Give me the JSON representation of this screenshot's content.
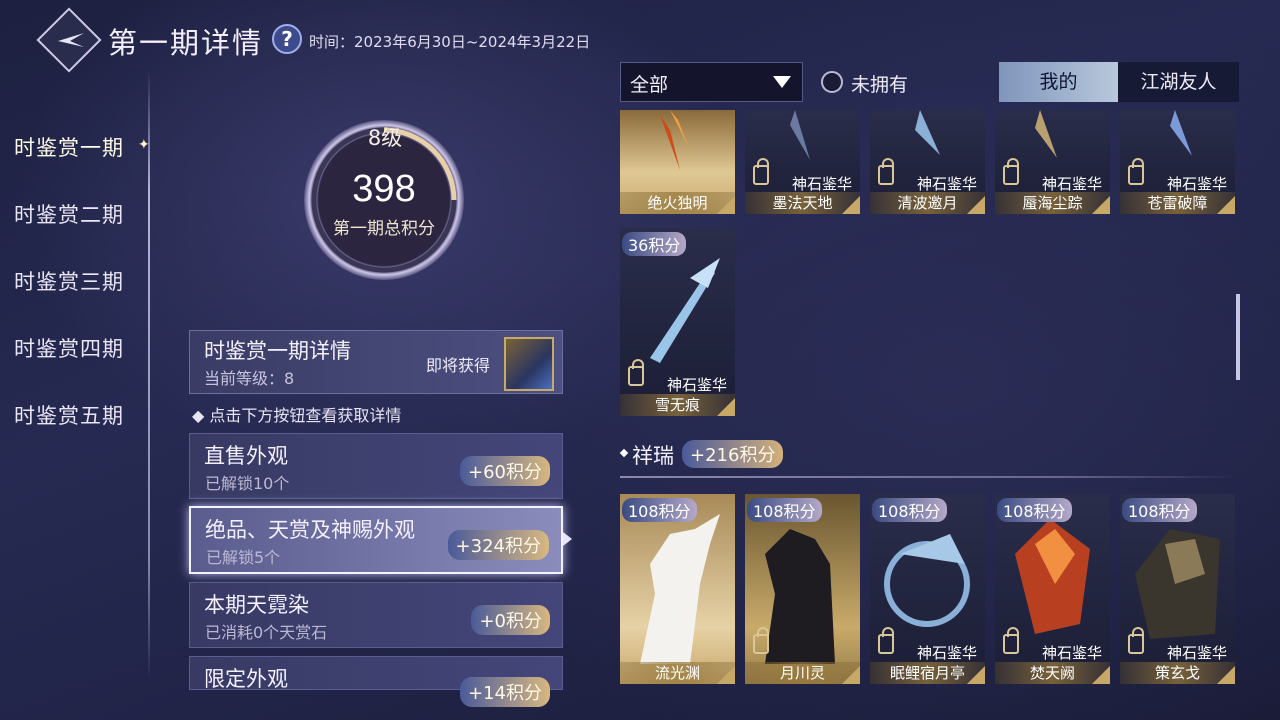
{
  "header": {
    "title": "第一期详情",
    "help_icon": "?",
    "time_label": "时间：",
    "time_range": "2023年6月30日~2024年3月22日"
  },
  "sidebar": {
    "items": [
      {
        "label": "时鉴赏一期",
        "active": true
      },
      {
        "label": "时鉴赏二期",
        "active": false
      },
      {
        "label": "时鉴赏三期",
        "active": false
      },
      {
        "label": "时鉴赏四期",
        "active": false
      },
      {
        "label": "时鉴赏五期",
        "active": false
      }
    ]
  },
  "progress": {
    "level": "8级",
    "score": "398",
    "label": "第一期总积分"
  },
  "detail": {
    "title": "时鉴赏一期详情",
    "current_level": "当前等级：8",
    "upcoming": "即将获得"
  },
  "hint": "点击下方按钮查看获取详情",
  "categories": [
    {
      "title": "直售外观",
      "sub": "已解锁10个",
      "points": "+60积分",
      "selected": false
    },
    {
      "title": "绝品、天赏及神赐外观",
      "sub": "已解锁5个",
      "points": "+324积分",
      "selected": true
    },
    {
      "title": "本期天霓染",
      "sub": "已消耗0个天赏石",
      "points": "+0积分",
      "selected": false
    },
    {
      "title": "限定外观",
      "sub": "",
      "points": "+14积分",
      "selected": false
    }
  ],
  "filter": {
    "selected": "全部"
  },
  "unowned_toggle": {
    "label": "未拥有",
    "checked": false
  },
  "tabs": [
    {
      "label": "我的",
      "active": true
    },
    {
      "label": "江湖友人",
      "active": false
    }
  ],
  "top_row": [
    {
      "name": "绝火独明",
      "source": "",
      "locked": false
    },
    {
      "name": "墨法天地",
      "source": "神石鉴华",
      "locked": true
    },
    {
      "name": "清波邀月",
      "source": "神石鉴华",
      "locked": true
    },
    {
      "name": "蜃海尘踪",
      "source": "神石鉴华",
      "locked": true
    },
    {
      "name": "苍雷破障",
      "source": "神石鉴华",
      "locked": true
    }
  ],
  "single_card": {
    "name": "雪无痕",
    "source": "神石鉴华",
    "points": "36积分",
    "locked": true
  },
  "section": {
    "title": "祥瑞",
    "points": "+216积分"
  },
  "mounts": [
    {
      "name": "流光渊",
      "points": "108积分",
      "source": "",
      "locked": false
    },
    {
      "name": "月川灵",
      "points": "108积分",
      "source": "",
      "locked": true
    },
    {
      "name": "眠鲤宿月亭",
      "points": "108积分",
      "source": "神石鉴华",
      "locked": true
    },
    {
      "name": "焚天阙",
      "points": "108积分",
      "source": "神石鉴华",
      "locked": true
    },
    {
      "name": "策玄戈",
      "points": "108积分",
      "source": "神石鉴华",
      "locked": true
    }
  ],
  "colors": {
    "accent_gold": "#d8b880",
    "panel": "#383a64",
    "selected_border": "#f4f2ff"
  }
}
